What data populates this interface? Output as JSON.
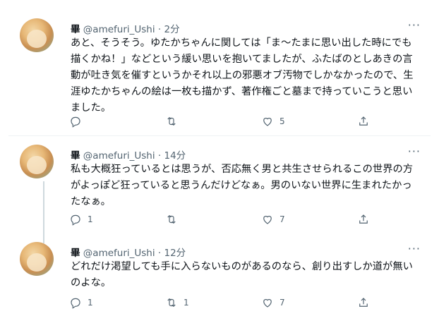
{
  "tweets": [
    {
      "name": "畢",
      "handle": "@amefuri_Ushi",
      "sep": "·",
      "time": "2分",
      "more": "···",
      "text": "あと、そうそう。ゆたかちゃんに関しては「ま〜たまに思い出した時にでも描くかね！」などという緩い思いを抱いてましたが、ふたばのとしあきの言動が吐き気を催すというかそれ以上の邪悪オブ汚物でしかなかったので、生涯ゆたかちゃんの絵は一枚も描かず、著作権ごと墓まで持っていこうと思いました。",
      "replies": "",
      "retweets": "",
      "likes": "5"
    },
    {
      "name": "畢",
      "handle": "@amefuri_Ushi",
      "sep": "·",
      "time": "14分",
      "more": "···",
      "text": "私も大概狂っているとは思うが、否応無く男と共生させられるこの世界の方がよっぽど狂っていると思うんだけどなぁ。男のいない世界に生まれたかったなぁ。",
      "replies": "1",
      "retweets": "",
      "likes": "7"
    },
    {
      "name": "畢",
      "handle": "@amefuri_Ushi",
      "sep": "·",
      "time": "12分",
      "more": "···",
      "text": "どれだけ渇望しても手に入らないものがあるのなら、創り出すしか道が無いのよな。",
      "replies": "1",
      "retweets": "1",
      "likes": "7"
    }
  ]
}
